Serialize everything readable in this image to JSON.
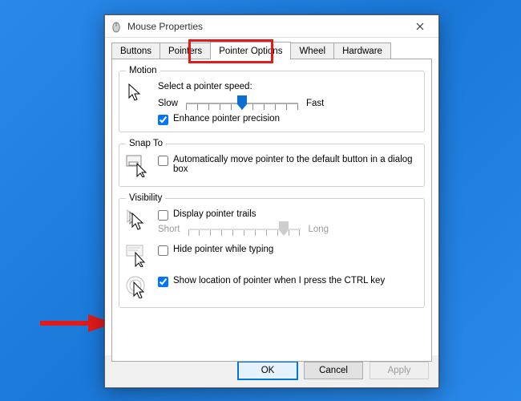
{
  "window": {
    "title": "Mouse Properties"
  },
  "tabs": {
    "t0": "Buttons",
    "t1": "Pointers",
    "t2": "Pointer Options",
    "t3": "Wheel",
    "t4": "Hardware",
    "active": "t2"
  },
  "motion": {
    "legend": "Motion",
    "label": "Select a pointer speed:",
    "slow": "Slow",
    "fast": "Fast",
    "speed_pos": 0.5,
    "enhance_label": "Enhance pointer precision",
    "enhance_checked": true
  },
  "snap": {
    "legend": "Snap To",
    "label": "Automatically move pointer to the default button in a dialog box",
    "checked": false
  },
  "visibility": {
    "legend": "Visibility",
    "trails_label": "Display pointer trails",
    "trails_checked": false,
    "short": "Short",
    "long": "Long",
    "trails_pos": 0.85,
    "hide_label": "Hide pointer while typing",
    "hide_checked": false,
    "ctrl_label": "Show location of pointer when I press the CTRL key",
    "ctrl_checked": true
  },
  "buttons": {
    "ok": "OK",
    "cancel": "Cancel",
    "apply": "Apply"
  }
}
